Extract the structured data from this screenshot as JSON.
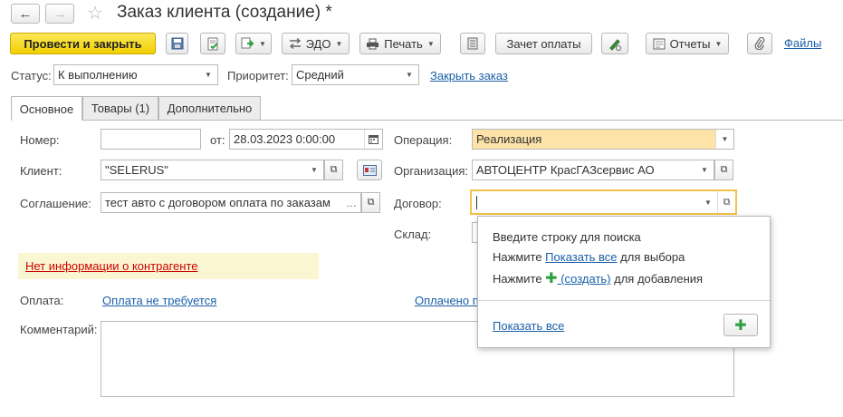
{
  "window": {
    "title": "Заказ клиента (создание) *",
    "back_icon": "←",
    "forward_icon": "→",
    "star_icon": "☆"
  },
  "toolbar": {
    "post_and_close": "Провести и закрыть",
    "edo": "ЭДО",
    "print": "Печать",
    "payment_offset": "Зачет оплаты",
    "reports": "Отчеты",
    "files": "Файлы"
  },
  "status_row": {
    "status_label": "Статус:",
    "status_value": "К выполнению",
    "priority_label": "Приоритет:",
    "priority_value": "Средний",
    "close_order": "Закрыть заказ"
  },
  "tabs": [
    {
      "label": "Основное"
    },
    {
      "label": "Товары (1)"
    },
    {
      "label": "Дополнительно"
    }
  ],
  "form": {
    "number_label": "Номер:",
    "number_value": "",
    "date_label": "от:",
    "date_value": "28.03.2023  0:00:00",
    "client_label": "Клиент:",
    "client_value": "\"SELERUS\"",
    "agreement_label": "Соглашение:",
    "agreement_value": "тест авто с договором оплата по заказам",
    "operation_label": "Операция:",
    "operation_value": "Реализация",
    "organization_label": "Организация:",
    "organization_value": "АВТОЦЕНТР КрасГАЗсервис АО",
    "contract_label": "Договор:",
    "contract_value": "",
    "warehouse_label": "Склад:",
    "warning": "Нет информации о контрагенте",
    "payment_label": "Оплата:",
    "payment_value": "Оплата не требуется",
    "paid_link": "Оплачено п",
    "comment_label": "Комментарий:",
    "comment_value": ""
  },
  "popup": {
    "line1": "Введите строку для поиска",
    "line2_prefix": "Нажмите ",
    "line2_link": "Показать все",
    "line2_suffix": " для выбора",
    "line3_prefix": "Нажмите ",
    "line3_link": " (создать)",
    "line3_suffix": " для добавления",
    "show_all": "Показать все",
    "plus_icon": "✚"
  },
  "colors": {
    "primary_button": "#f2d000",
    "operation_highlight": "#fde3a8",
    "focus_border": "#f3c24a",
    "link": "#1a5fa8",
    "warning_text": "#cc0000",
    "warning_bg": "#fbf6d2",
    "plus_green": "#2ea043"
  }
}
